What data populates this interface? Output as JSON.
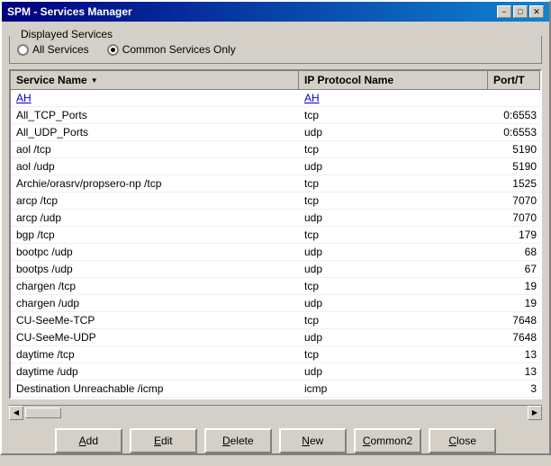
{
  "window": {
    "title": "SPM - Services Manager"
  },
  "title_buttons": {
    "minimize": "−",
    "maximize": "□",
    "close": "✕"
  },
  "group_box": {
    "legend": "Displayed Services"
  },
  "radio_options": [
    {
      "id": "all",
      "label": "All Services",
      "checked": false
    },
    {
      "id": "common",
      "label": "Common Services Only",
      "checked": true
    }
  ],
  "table": {
    "columns": [
      {
        "id": "service",
        "label": "Service Name",
        "sort": true
      },
      {
        "id": "ip",
        "label": "IP Protocol Name"
      },
      {
        "id": "port",
        "label": "Port/T"
      }
    ],
    "rows": [
      {
        "service": "AH",
        "service_link": true,
        "ip": "AH",
        "ip_link": true,
        "port": ""
      },
      {
        "service": "All_TCP_Ports",
        "service_link": false,
        "ip": "tcp",
        "ip_link": false,
        "port": "0:6553"
      },
      {
        "service": "All_UDP_Ports",
        "service_link": false,
        "ip": "udp",
        "ip_link": false,
        "port": "0:6553"
      },
      {
        "service": "aol /tcp",
        "service_link": false,
        "ip": "tcp",
        "ip_link": false,
        "port": "5190"
      },
      {
        "service": "aol /udp",
        "service_link": false,
        "ip": "udp",
        "ip_link": false,
        "port": "5190"
      },
      {
        "service": "Archie/orasrv/propsero-np /tcp",
        "service_link": false,
        "ip": "tcp",
        "ip_link": false,
        "port": "1525"
      },
      {
        "service": "arcp /tcp",
        "service_link": false,
        "ip": "tcp",
        "ip_link": false,
        "port": "7070"
      },
      {
        "service": "arcp /udp",
        "service_link": false,
        "ip": "udp",
        "ip_link": false,
        "port": "7070"
      },
      {
        "service": "bgp /tcp",
        "service_link": false,
        "ip": "tcp",
        "ip_link": false,
        "port": "179"
      },
      {
        "service": "bootpc /udp",
        "service_link": false,
        "ip": "udp",
        "ip_link": false,
        "port": "68"
      },
      {
        "service": "bootps /udp",
        "service_link": false,
        "ip": "udp",
        "ip_link": false,
        "port": "67"
      },
      {
        "service": "chargen /tcp",
        "service_link": false,
        "ip": "tcp",
        "ip_link": false,
        "port": "19"
      },
      {
        "service": "chargen /udp",
        "service_link": false,
        "ip": "udp",
        "ip_link": false,
        "port": "19"
      },
      {
        "service": "CU-SeeMe-TCP",
        "service_link": false,
        "ip": "tcp",
        "ip_link": false,
        "port": "7648"
      },
      {
        "service": "CU-SeeMe-UDP",
        "service_link": false,
        "ip": "udp",
        "ip_link": false,
        "port": "7648"
      },
      {
        "service": "daytime /tcp",
        "service_link": false,
        "ip": "tcp",
        "ip_link": false,
        "port": "13"
      },
      {
        "service": "daytime /udp",
        "service_link": false,
        "ip": "udp",
        "ip_link": false,
        "port": "13"
      },
      {
        "service": "Destination Unreachable /icmp",
        "service_link": false,
        "ip": "icmp",
        "ip_link": false,
        "port": "3"
      }
    ]
  },
  "buttons": [
    {
      "id": "add",
      "label": "Add",
      "underline_index": 0
    },
    {
      "id": "edit",
      "label": "Edit",
      "underline_index": 0
    },
    {
      "id": "delete",
      "label": "Delete",
      "underline_index": 0
    },
    {
      "id": "new",
      "label": "New",
      "underline_index": 0
    },
    {
      "id": "common2",
      "label": "Common2",
      "underline_index": 0
    },
    {
      "id": "close",
      "label": "Close",
      "underline_index": 0
    }
  ]
}
